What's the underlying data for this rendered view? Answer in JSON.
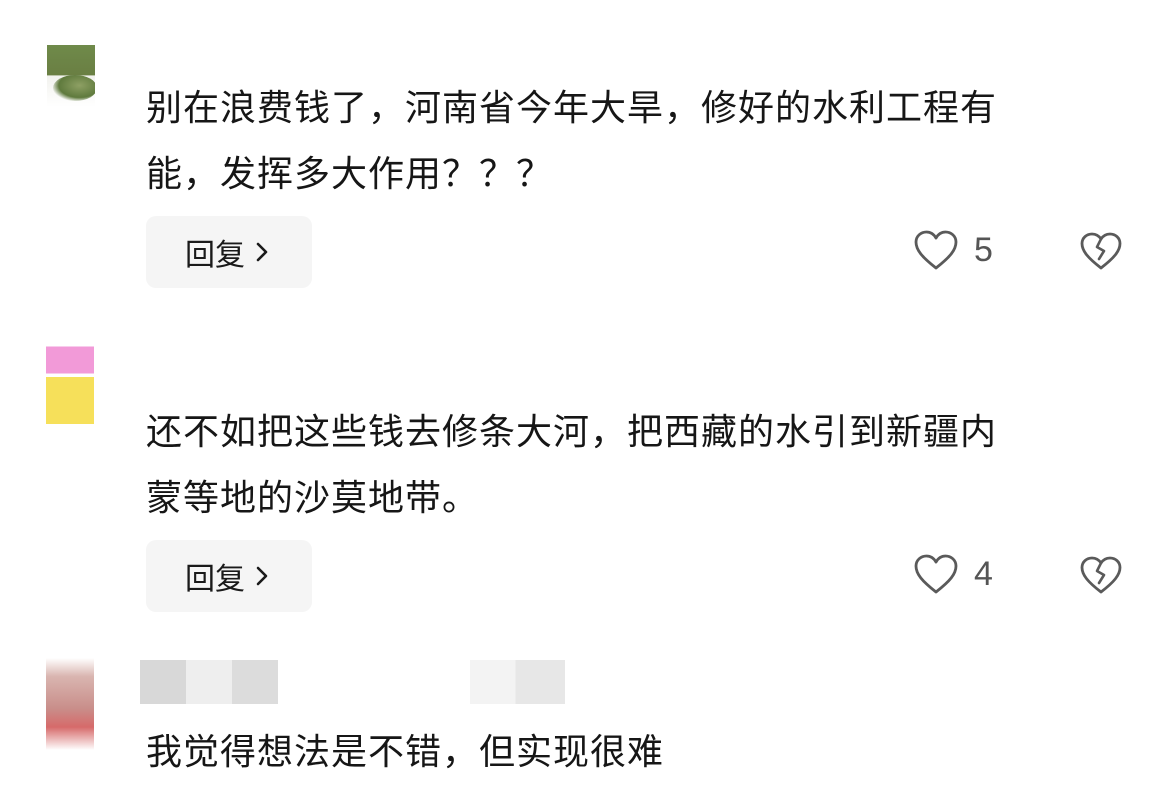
{
  "comments": [
    {
      "text": "别在浪费钱了，河南省今年大旱，修好的水利工程有\n能，发挥多大作用？？？",
      "reply_label": "回复",
      "like_count": "5"
    },
    {
      "text": "还不如把这些钱去修条大河，把西藏的水引到新疆内\n蒙等地的沙莫地带。",
      "reply_label": "回复",
      "like_count": "4"
    },
    {
      "text": "我觉得想法是不错，但实现很难"
    }
  ],
  "icons": {
    "like": "heart-outline-icon",
    "dislike": "broken-heart-icon",
    "reply_chevron": "chevron-right-icon"
  },
  "colors": {
    "text": "#161616",
    "muted": "#555555",
    "reply_bg": "#f5f5f5",
    "icon_stroke": "#5a5a5a"
  }
}
